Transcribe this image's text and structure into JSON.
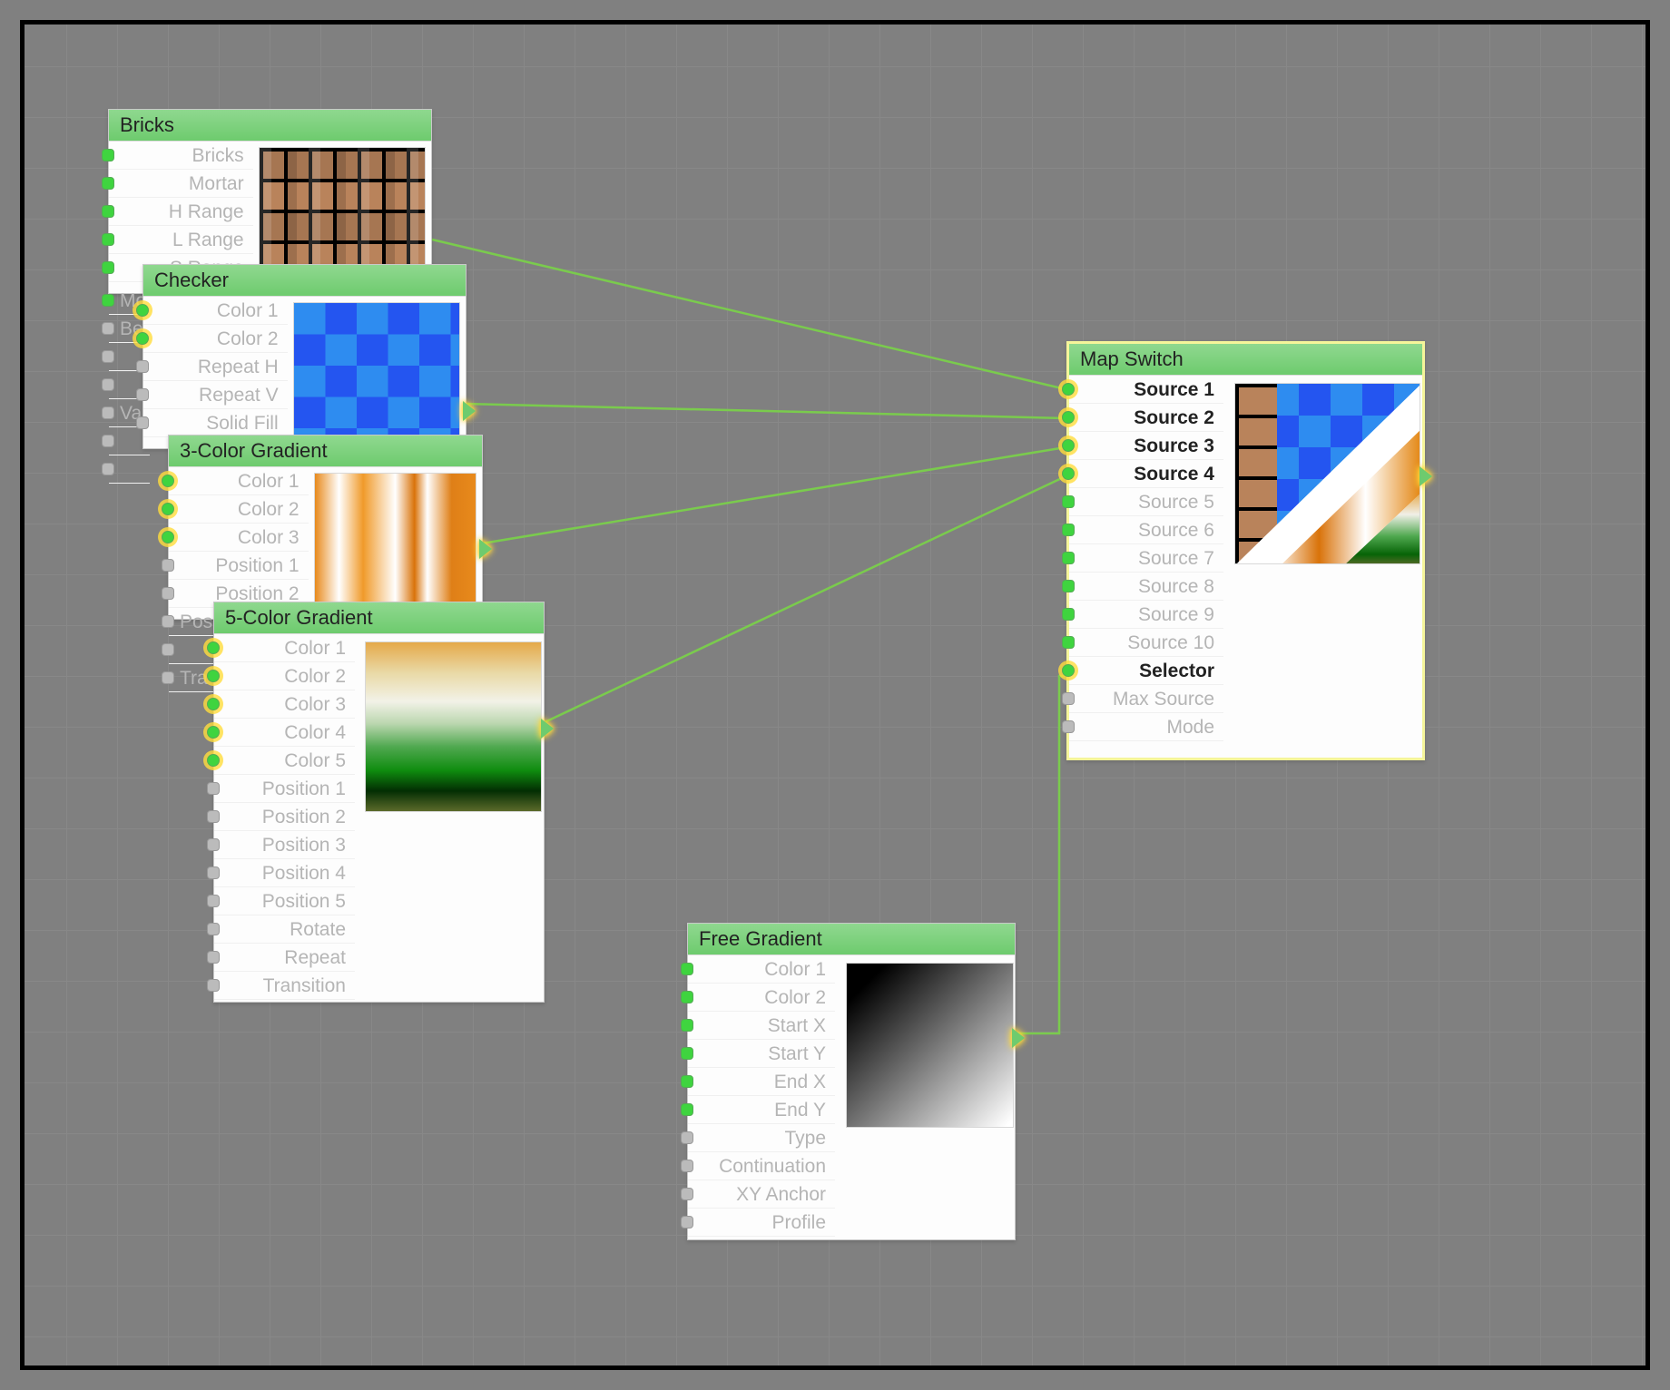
{
  "colors": {
    "node_header": "#6ecb6e",
    "port_active": "#3fd43f",
    "connection": "#7acb4d"
  },
  "nodes": {
    "bricks": {
      "title": "Bricks",
      "params": [
        "Bricks",
        "Mortar",
        "H Range",
        "L Range",
        "S Range",
        "Mor",
        "Be",
        "",
        "",
        "Va",
        "",
        ""
      ]
    },
    "checker": {
      "title": "Checker",
      "params": [
        "Color 1",
        "Color 2",
        "Repeat H",
        "Repeat V",
        "Solid Fill"
      ]
    },
    "grad3": {
      "title": "3-Color Gradient",
      "params": [
        "Color 1",
        "Color 2",
        "Color 3",
        "Position 1",
        "Position 2",
        "Pos",
        "",
        "Tra"
      ]
    },
    "grad5": {
      "title": "5-Color Gradient",
      "params": [
        "Color 1",
        "Color 2",
        "Color 3",
        "Color 4",
        "Color 5",
        "Position 1",
        "Position 2",
        "Position 3",
        "Position 4",
        "Position 5",
        "Rotate",
        "Repeat",
        "Transition"
      ]
    },
    "free": {
      "title": "Free Gradient",
      "params": [
        "Color 1",
        "Color 2",
        "Start X",
        "Start Y",
        "End X",
        "End Y",
        "Type",
        "Continuation",
        "XY Anchor",
        "Profile"
      ]
    },
    "mapswitch": {
      "title": "Map Switch",
      "params": [
        {
          "label": "Source 1",
          "active": true
        },
        {
          "label": "Source 2",
          "active": true
        },
        {
          "label": "Source 3",
          "active": true
        },
        {
          "label": "Source 4",
          "active": true
        },
        {
          "label": "Source 5",
          "active": false
        },
        {
          "label": "Source 6",
          "active": false
        },
        {
          "label": "Source 7",
          "active": false
        },
        {
          "label": "Source 8",
          "active": false
        },
        {
          "label": "Source 9",
          "active": false
        },
        {
          "label": "Source 10",
          "active": false
        },
        {
          "label": "Selector",
          "active": true
        },
        {
          "label": "Max Source",
          "active": false
        },
        {
          "label": "Mode",
          "active": false
        }
      ]
    }
  }
}
